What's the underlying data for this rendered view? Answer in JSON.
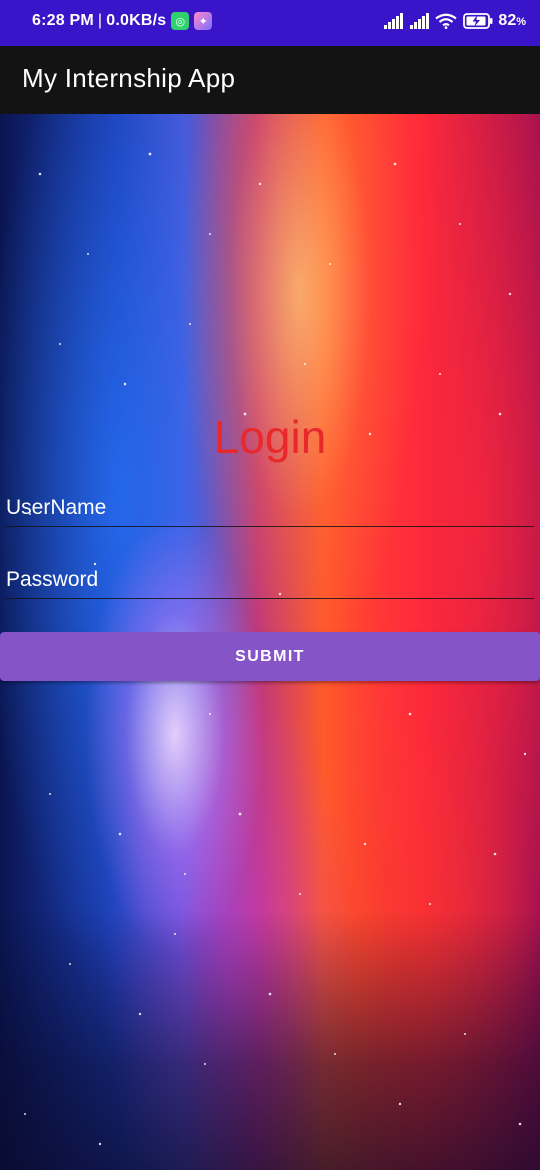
{
  "status_bar": {
    "time": "6:28 PM",
    "separator": "|",
    "network_speed": "0.0KB/s",
    "battery_percent": "82",
    "battery_unit": "%",
    "icons": [
      "chat-app-notification-icon",
      "gallery-app-notification-icon",
      "signal-icon",
      "signal-icon",
      "wifi-icon",
      "battery-charging-icon"
    ],
    "background_color": "#3a14c8"
  },
  "app_bar": {
    "title": "My Internship App",
    "background_color": "#131313"
  },
  "login": {
    "title": "Login",
    "title_color": "#e8282a",
    "username_placeholder": "UserName",
    "username_value": "",
    "password_placeholder": "Password",
    "password_value": "",
    "submit_label": "SUBMIT",
    "submit_color": "#8554c6"
  }
}
